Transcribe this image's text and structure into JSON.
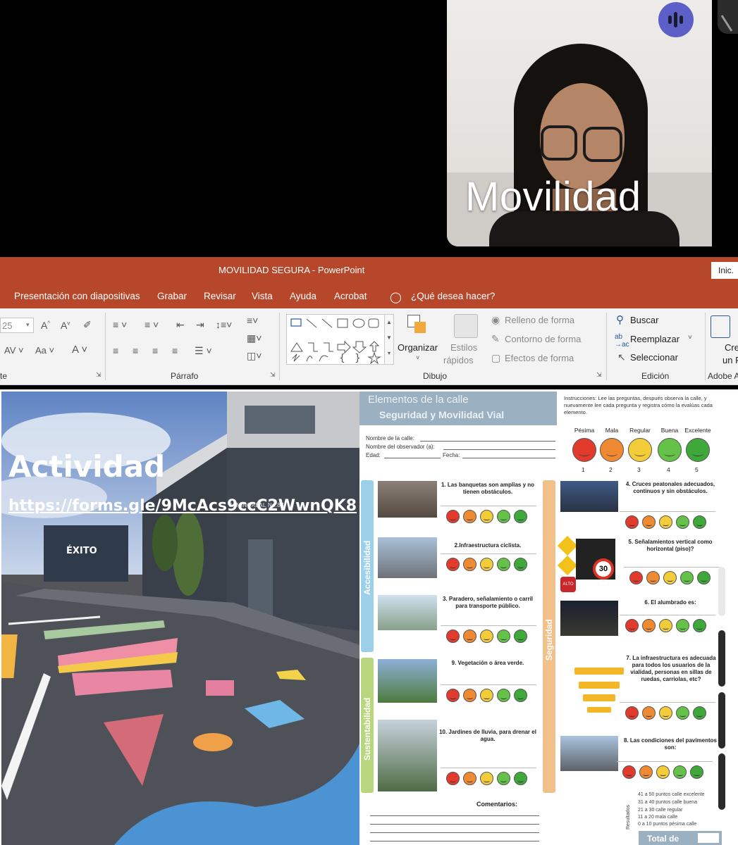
{
  "video": {
    "participant_name": "Movilidad",
    "speaking_indicator": "audio-bars-icon"
  },
  "powerpoint": {
    "window_title": "MOVILIDAD SEGURA  -  PowerPoint",
    "signin_button": "Inic.",
    "menu": [
      "Presentación con diapositivas",
      "Grabar",
      "Revisar",
      "Vista",
      "Ayuda",
      "Acrobat"
    ],
    "tell_me": "¿Qué desea hacer?",
    "ribbon": {
      "font_size": "25",
      "groups": {
        "font_label": "te",
        "paragraph_label": "Párrafo",
        "drawing_label": "Dibujo",
        "editing_label": "Edición",
        "adobe_label": "Adobe A"
      },
      "organize": "Organizar",
      "quick_styles_1": "Estilos",
      "quick_styles_2": "rápidos",
      "shape_fill": "Relleno de forma",
      "shape_outline": "Contorno de forma",
      "shape_effects": "Efectos de forma",
      "find": "Buscar",
      "replace": "Reemplazar",
      "select": "Seleccionar",
      "adobe_1": "Cre",
      "adobe_2": "un P"
    }
  },
  "slide": {
    "activity_title": "Actividad",
    "activity_link": "https://forms.gle/9McAcs9ccC2WwnQK8",
    "photo_sign": "CAMINOREAL No.84",
    "worksheet": {
      "title_1": "Elementos de la calle",
      "title_2": "Seguridad y Movilidad Vial",
      "field_street": "Nombre de la calle:",
      "field_observer": "Nombre del observador (a):",
      "field_age": "Edad:",
      "field_date": "Fecha:",
      "instructions": "Instrucciones: Lee las preguntas, después observa la calle, y nuevamente lee cada pregunta y registra cómo la evalúas cada elemento.",
      "scale": [
        {
          "label": "Pésima",
          "num": "1",
          "color": "#e23b2e"
        },
        {
          "label": "Mala",
          "num": "2",
          "color": "#f08a32"
        },
        {
          "label": "Regular",
          "num": "3",
          "color": "#f3cc3a"
        },
        {
          "label": "Buena",
          "num": "4",
          "color": "#63c247"
        },
        {
          "label": "Excelente",
          "num": "5",
          "color": "#3ea83a"
        }
      ],
      "section_accesibilidad": "Accesibilidad",
      "section_sustentabilidad": "Sustentabilidad",
      "section_seguridad": "Seguridad",
      "questions_left": [
        "1. Las banquetas son amplias y no tienen obstáculos.",
        "2.Infraestructura ciclista.",
        "3. Paradero, señalamiento o carril para transporte público.",
        "9. Vegetación o área verde.",
        "10. Jardines de lluvia, para drenar el agua."
      ],
      "questions_right": [
        "4. Cruces peatonales adecuados, continuos y sin obstáculos.",
        "5. Señalamientos vertical como horizontal (piso)?",
        "6. El alumbrado es:",
        "7. La infraestructura es adecuada para todos los usuarios de la vialidad, personas en sillas de ruedas, carriolas, etc?",
        "8. Las condiciones del pavimentos son:"
      ],
      "comments_label": "Comentarios:",
      "results_label": "Resultados",
      "results": [
        "41 a 50 puntos calle excelente",
        "31 a 40 puntos calle buena",
        "21 a 30 calle regular",
        "11 a 20 mala calle",
        "0 a 10 puntos pésima calle"
      ],
      "total_label": "Total de",
      "sign_speed": "30",
      "sign_stop": "ALTO"
    }
  }
}
